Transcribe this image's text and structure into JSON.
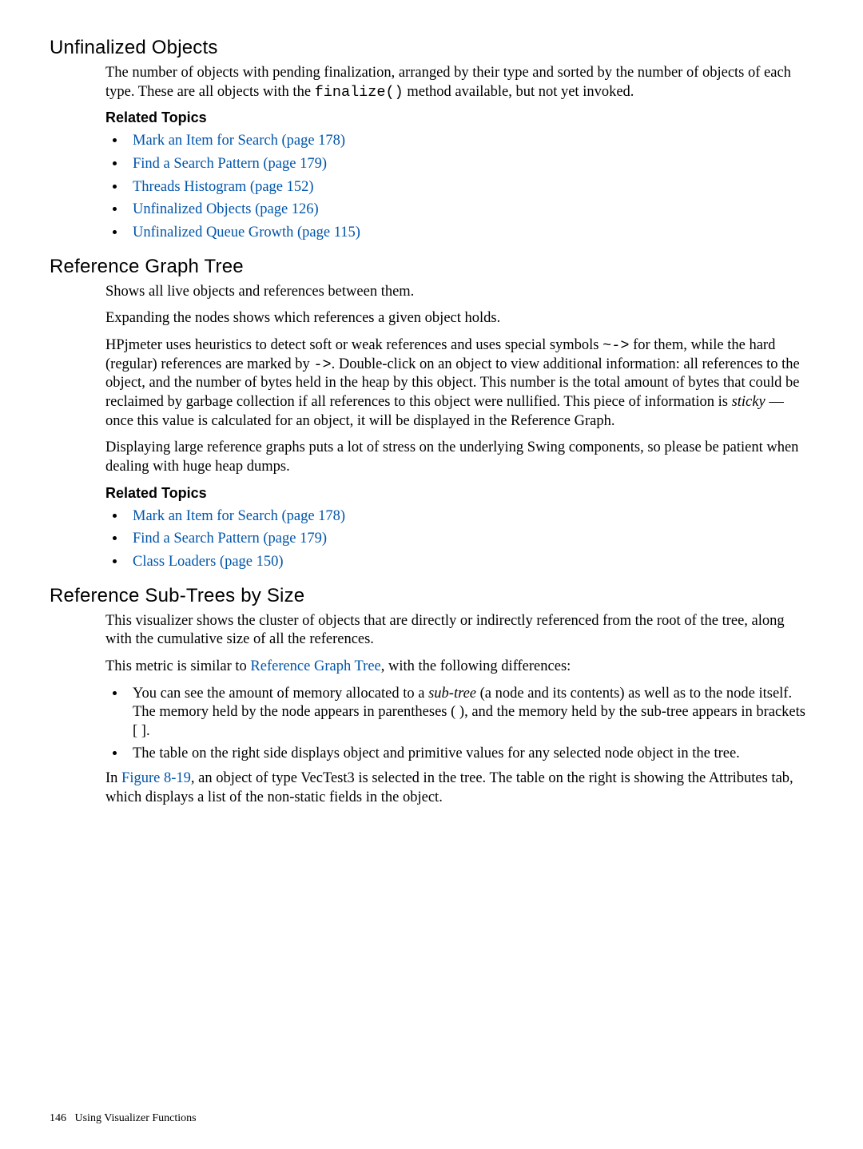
{
  "section1": {
    "heading": "Unfinalized Objects",
    "p1_a": "The number of objects with pending finalization, arranged by their type and sorted by the number of objects of each type. These are all objects with the ",
    "p1_code": "finalize()",
    "p1_b": " method available, but not yet invoked.",
    "related_heading": "Related Topics",
    "topics": [
      "Mark an Item for Search (page 178)",
      "Find a Search Pattern (page 179)",
      "Threads Histogram (page 152)",
      "Unfinalized Objects (page 126)",
      "Unfinalized Queue Growth (page 115)"
    ]
  },
  "section2": {
    "heading": "Reference Graph Tree",
    "p1": "Shows all live objects and references between them.",
    "p2": "Expanding the nodes shows which references a given object holds.",
    "p3_a": "HPjmeter uses heuristics to detect soft or weak references and uses special symbols ",
    "p3_sym1": "~->",
    "p3_b": " for them, while the hard (regular) references are marked by ",
    "p3_sym2": "->",
    "p3_c": ". Double-click on an object to view additional information: all references to the object, and the number of bytes held in the heap by this object. This number is the total amount of bytes that could be reclaimed by garbage collection if all references to this object were nullified. This piece of information is ",
    "p3_sticky": "sticky",
    "p3_d": " — once this value is calculated for an object, it will be displayed in the Reference Graph.",
    "p4": "Displaying large reference graphs puts a lot of stress on the underlying Swing components, so please be patient when dealing with huge heap dumps.",
    "related_heading": "Related Topics",
    "topics": [
      "Mark an Item for Search (page 178)",
      "Find a Search Pattern (page 179)",
      "Class Loaders (page 150)"
    ]
  },
  "section3": {
    "heading": "Reference Sub-Trees by Size",
    "p1": "This visualizer shows the cluster of objects that are directly or indirectly referenced from the root of the tree, along with the cumulative size of all the references.",
    "p2_a": "This metric is similar to ",
    "p2_link": "Reference Graph Tree",
    "p2_b": ", with the following differences:",
    "bul1_a": "You can see the amount of memory allocated to a ",
    "bul1_em": "sub-tree",
    "bul1_b": " (a node and its contents) as well as to the node itself. The memory held by the node appears in parentheses ( ), and the memory held by the sub-tree appears in brackets [ ].",
    "bul2": "The table on the right side displays object and primitive values for any selected node object in the tree.",
    "p3_a": "In ",
    "p3_link": "Figure 8-19",
    "p3_b": ", an object of type VecTest3 is selected in the tree. The table on the right is showing the Attributes tab, which displays a list of the non-static fields in the object."
  },
  "footer": {
    "pagenum": "146",
    "chapter": "Using Visualizer Functions"
  }
}
